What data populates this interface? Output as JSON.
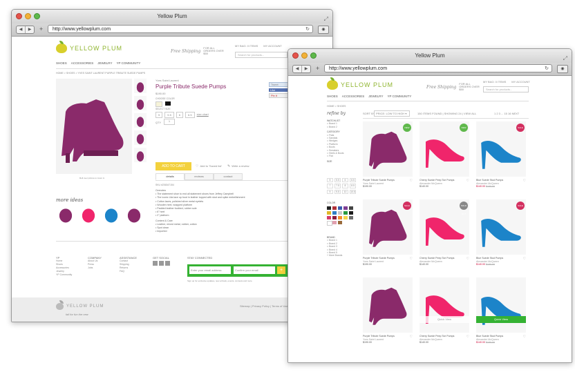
{
  "colors": {
    "purple": "#8a2a6a",
    "pink": "#f0256b",
    "blue": "#1c84c9",
    "yellow": "#f3d13d",
    "green": "#35b233",
    "olive": "#8fb52f"
  },
  "window_back": {
    "title": "Yellow Plum",
    "url": "http://www.yellowplum.com",
    "brand": "YELLOW PLUM",
    "free_shipping": "Free Shipping",
    "free_shipping_note": "FOR ALL ORDERS OVER $50",
    "bag": "MY BAG: 0 ITEMS",
    "account": "MY ACCOUNT",
    "search_placeholder": "Search for products...",
    "nav": [
      "SHOES",
      "ACCESSORIES",
      "JEWELRY",
      "YP COMMUNITY"
    ],
    "breadcrumb": "HOME > SHOES > YVES SAINT LAURENT PURPLE TRIBUTE SUEDE PUMPS",
    "designer": "Yves Saint Laurent",
    "product_title": "Purple Tribute Suede Pumps",
    "price": "$190.00",
    "choose_color": "CHOOSE COLOR",
    "select_size": "SELECT SIZE",
    "sizes": [
      "5",
      "5.5",
      "6",
      "6.5"
    ],
    "size_chart": "size chart",
    "qty": "QTY",
    "qty_value": "1",
    "add_to_cart": "ADD TO CART",
    "add_saved": "Add to 'Saved list'",
    "write_review": "Write a review",
    "social": [
      "Tweet",
      "Like",
      "Pin it"
    ],
    "tabs": [
      "details",
      "reviews",
      "contact"
    ],
    "sku": "SKU #236347154",
    "overview_heading": "Overview",
    "overview": [
      "The statement shoe to end all statement shoes from Jeffrey Campbell",
      "The iconic Lita lace up boot in leather topped with stud and spike embellishment",
      "Cotton laces, polished silver metal eyelets",
      "Wooden heel, wrapped platform",
      "Padded leather footbed, rubber sole",
      "6\" heel",
      "2\" platform"
    ],
    "care_heading": "Content & Care",
    "care": [
      "Leather, mixed metal, rubber, cotton",
      "Spot clean",
      "Imported"
    ],
    "more_ideas": "more ideas",
    "zoom_hint": "Roll over picture to zoom in",
    "footer_cols": [
      {
        "title": "YP",
        "items": [
          "Home",
          "Shoes",
          "Accessories",
          "Jewelry",
          "YP Community"
        ]
      },
      {
        "title": "COMPANY",
        "items": [
          "About Us",
          "Press",
          "Jobs"
        ]
      },
      {
        "title": "ASSISTANCE",
        "items": [
          "Contact",
          "Shipping",
          "Returns",
          "FAQ"
        ]
      },
      {
        "title": "GET SOCIAL",
        "items": []
      }
    ],
    "stay_connected": "STAY CONNECTED",
    "email_placeholder": "Enter your email address",
    "confirm_placeholder": "Confirm your email",
    "signup_note": "Sign up for exclusive updates, new arrivals, events, contests and more",
    "tagline": "fall for fun the new",
    "legal": "Sitemap | Privacy Policy | Terms of Use"
  },
  "window_front": {
    "title": "Yellow Plum",
    "url": "http://www.yellowplum.com",
    "breadcrumb": "HOME > SHOES",
    "refine": "refine by",
    "sort_by": "SORT BY",
    "sort_value": "PRICE: LOW TO HIGH",
    "results": "150 ITEMS FOUND | SHOWING 24 | VIEW ALL",
    "pages": "1 2 3 ... 15 16 NEXT",
    "filter_groups": [
      {
        "title": "WATCHLIST",
        "items": [
          "Brand 1",
          "Brand 2"
        ]
      },
      {
        "title": "CATEGORY",
        "items": [
          "Flats",
          "Sandals",
          "Wedges",
          "Platform",
          "Boots",
          "Sneakers",
          "Heels & Boots",
          "Flat"
        ]
      },
      {
        "title": "SIZE",
        "items": []
      },
      {
        "title": "COLOR",
        "items": []
      },
      {
        "title": "BRAND",
        "items": [
          "Brand 1",
          "Brand 2",
          "Brand 3",
          "Brand 4",
          "Brand 5",
          "More Brands"
        ]
      }
    ],
    "sizes": [
      "5",
      "5.5",
      "6",
      "6.5",
      "7",
      "7.5",
      "8",
      "8.5",
      "9",
      "9.5",
      "10",
      "10.5"
    ],
    "color_swatches": [
      "#222222",
      "#b03038",
      "#3b5db0",
      "#7f3e93",
      "#444444",
      "#e0b828",
      "#2f7fc5",
      "#c8c8c8",
      "#2a9a40",
      "#1c1c1c",
      "#d43c6a",
      "#8a1e3e",
      "#f48c2b",
      "#f5d64a",
      "#6d6d6d",
      "#ffffff",
      "#e2a0b0",
      "#9a6a3a"
    ],
    "products": [
      {
        "name": "Purple Tribute Suede Pumps",
        "brand": "Yves Saint Laurent",
        "price": "$190.00",
        "badge": "NEW",
        "color": "purple"
      },
      {
        "name": "Cherry Suede Peep Toe Pumps",
        "brand": "Alexander McQueen",
        "price": "$140.00",
        "badge": "NEW",
        "color": "pink"
      },
      {
        "name": "Blue Suede Stud Pumps",
        "brand": "Alexander McQueen",
        "price": "$140.00",
        "old_price": "$190.00",
        "badge": "SALE",
        "color": "blue"
      },
      {
        "name": "Purple Tribute Suede Pumps",
        "brand": "Yves Saint Laurent",
        "price": "$190.00",
        "badge": "SALE",
        "color": "purple"
      },
      {
        "name": "Cherry Suede Peep Toe Pumps",
        "brand": "Alexander McQueen",
        "price": "$140.00",
        "badge": "SOLD OUT",
        "color": "pink"
      },
      {
        "name": "Blue Suede Stud Pumps",
        "brand": "Alexander McQueen",
        "price": "$140.00",
        "old_price": "$190.00",
        "badge": "SALE",
        "color": "blue"
      },
      {
        "name": "Purple Tribute Suede Pumps",
        "brand": "Yves Saint Laurent",
        "price": "$190.00",
        "badge": "",
        "color": "purple"
      },
      {
        "name": "Cherry Suede Peep Toe Pumps",
        "brand": "Alexander McQueen",
        "price": "$140.00",
        "badge": "",
        "color": "pink",
        "quick_view": "Quick View"
      },
      {
        "name": "Blue Suede Stud Pumps",
        "brand": "Alexander McQueen",
        "price": "$140.00",
        "old_price": "$190.00",
        "badge": "",
        "color": "blue",
        "quick_view": "Quick View"
      }
    ]
  }
}
